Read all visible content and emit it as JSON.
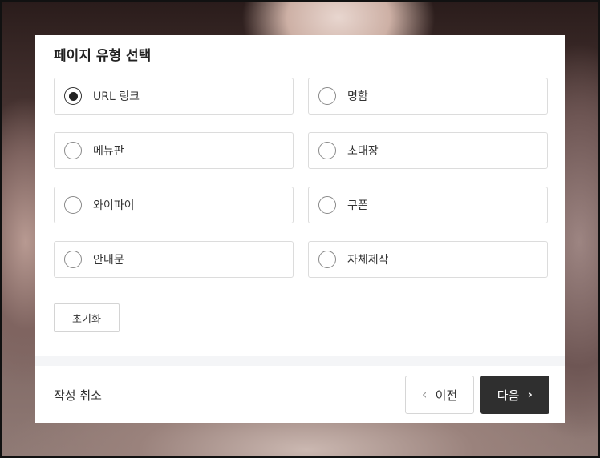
{
  "modal": {
    "title": "페이지 유형 선택",
    "options": [
      {
        "label": "URL 링크",
        "selected": true
      },
      {
        "label": "명함",
        "selected": false
      },
      {
        "label": "메뉴판",
        "selected": false
      },
      {
        "label": "초대장",
        "selected": false
      },
      {
        "label": "와이파이",
        "selected": false
      },
      {
        "label": "쿠폰",
        "selected": false
      },
      {
        "label": "안내문",
        "selected": false
      },
      {
        "label": "자체제작",
        "selected": false
      }
    ],
    "reset_label": "초기화"
  },
  "footer": {
    "cancel_label": "작성 취소",
    "prev_label": "이전",
    "next_label": "다음"
  },
  "colors": {
    "primary_button": "#2f2f2f",
    "border": "#dcdcdc",
    "divider": "#f4f5f7"
  },
  "icons": {
    "prev": "chevron-left-icon",
    "next": "chevron-right-icon"
  }
}
